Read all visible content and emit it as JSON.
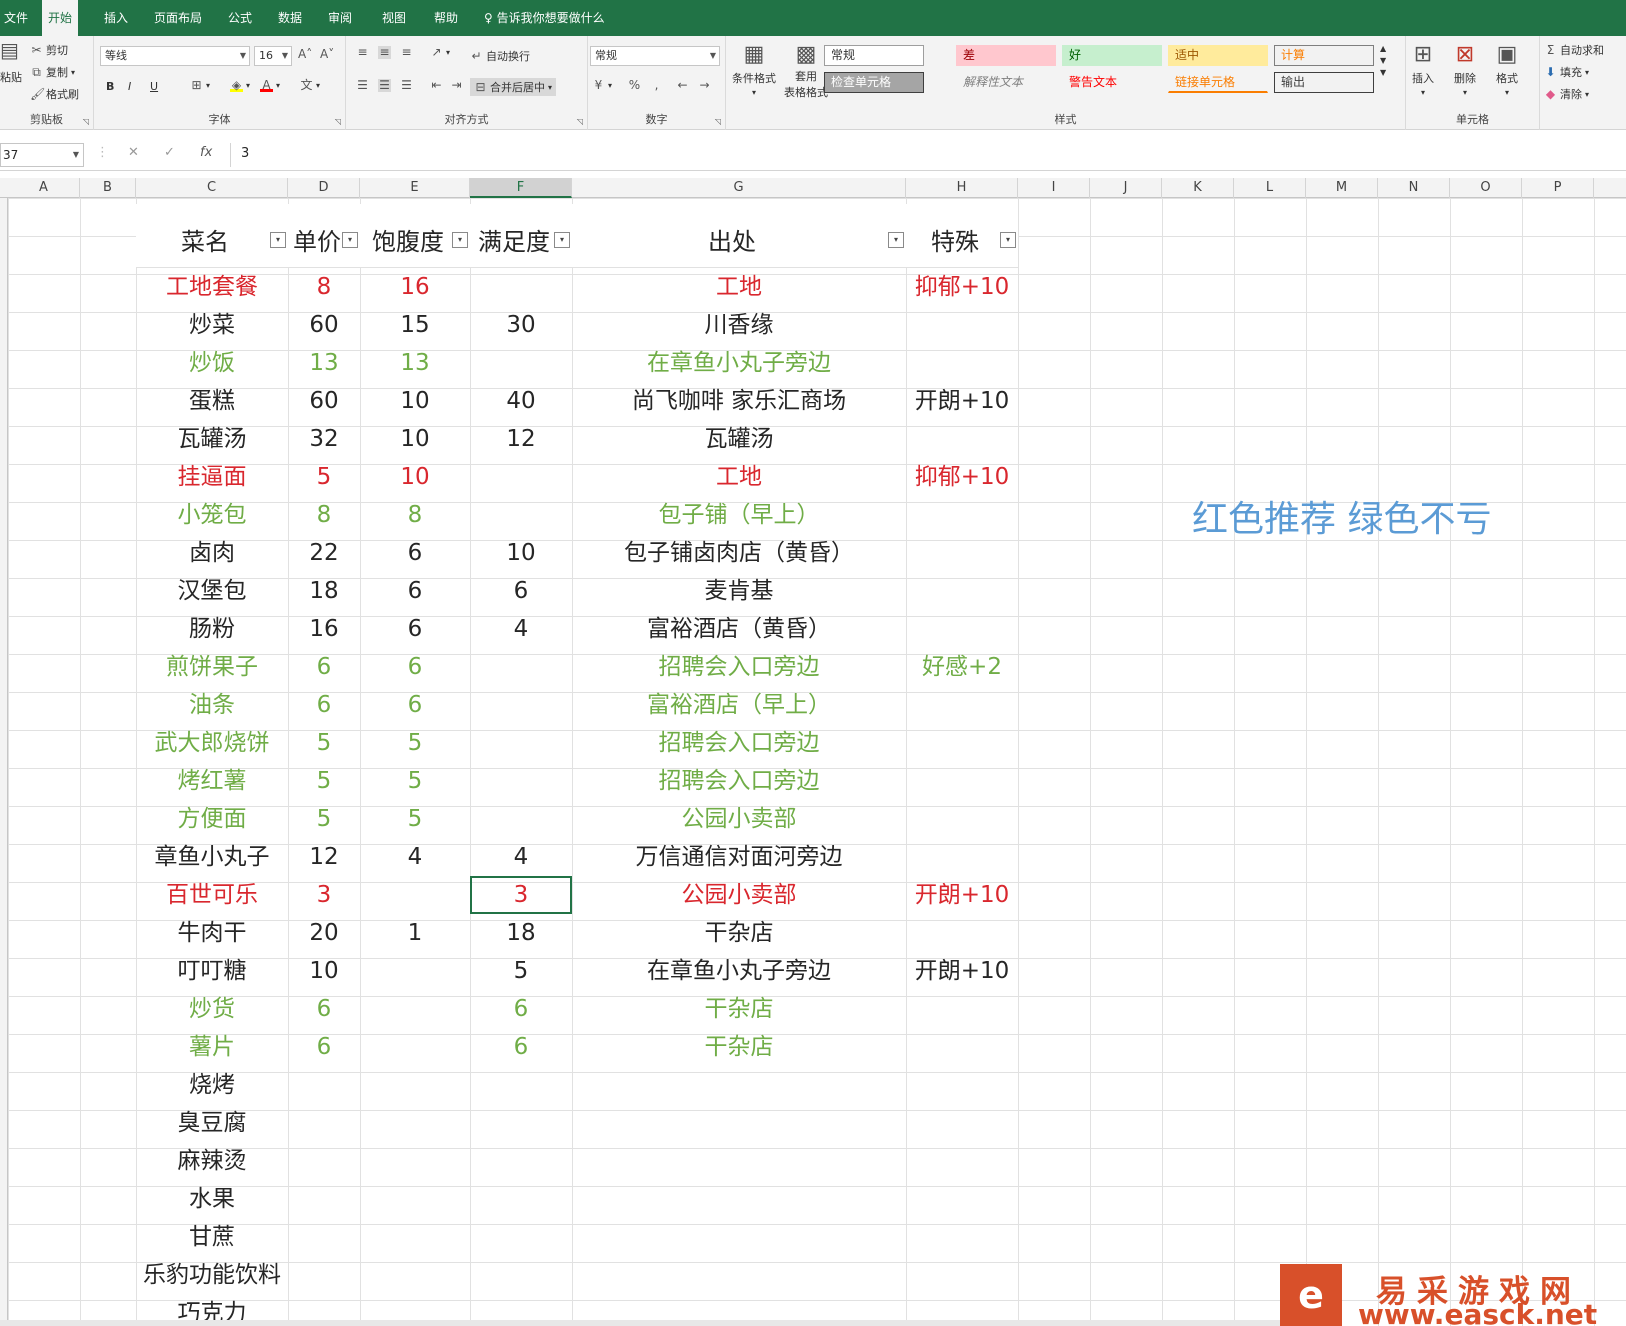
{
  "menu": {
    "tabs": [
      "文件",
      "开始",
      "插入",
      "页面布局",
      "公式",
      "数据",
      "审阅",
      "视图",
      "帮助"
    ],
    "active_index": 1,
    "tell_me": "告诉我你想要做什么"
  },
  "ribbon": {
    "clipboard": {
      "paste": "粘贴",
      "cut": "剪切",
      "copy": "复制",
      "format_painter": "格式刷",
      "label": "剪贴板"
    },
    "font": {
      "name": "等线",
      "size": "16",
      "bold": "B",
      "italic": "I",
      "underline": "U",
      "label": "字体"
    },
    "alignment": {
      "wrap": "自动换行",
      "merge": "合并后居中",
      "label": "对齐方式"
    },
    "number": {
      "format": "常规",
      "label": "数字"
    },
    "styles": {
      "conditional": "条件格式",
      "table_fmt_1": "套用",
      "table_fmt_2": "表格格式",
      "cells": [
        {
          "text": "常规",
          "bg": "#ffffff",
          "color": "#333333",
          "border": "#9e9e9e"
        },
        {
          "text": "差",
          "bg": "#ffc7ce",
          "color": "#9c0006",
          "border": "#ffc7ce"
        },
        {
          "text": "好",
          "bg": "#c6efce",
          "color": "#006100",
          "border": "#c6efce"
        },
        {
          "text": "适中",
          "bg": "#ffeb9c",
          "color": "#9c5700",
          "border": "#ffeb9c"
        },
        {
          "text": "计算",
          "bg": "#f2f2f2",
          "color": "#fa7d00",
          "border": "#7f7f7f"
        },
        {
          "text": "检查单元格",
          "bg": "#a5a5a5",
          "color": "#ffffff",
          "border": "#3f3f3f"
        },
        {
          "text": "解释性文本",
          "bg": "#f3f3f3",
          "color": "#7f7f7f",
          "border": "#f3f3f3"
        },
        {
          "text": "警告文本",
          "bg": "#f3f3f3",
          "color": "#ff0000",
          "border": "#f3f3f3"
        },
        {
          "text": "链接单元格",
          "bg": "#f3f3f3",
          "color": "#fa7d00",
          "border": "#f3f3f3"
        },
        {
          "text": "输出",
          "bg": "#f2f2f2",
          "color": "#3f3f3f",
          "border": "#3f3f3f"
        }
      ],
      "label": "样式"
    },
    "cells_group": {
      "insert": "插入",
      "delete": "删除",
      "format": "格式",
      "label": "单元格"
    },
    "editing": {
      "autosum": "自动求和",
      "fill": "填充",
      "clear": "清除"
    }
  },
  "formula_bar": {
    "name_box": "37",
    "formula": "3",
    "fx": "fx"
  },
  "columns": [
    "A",
    "B",
    "C",
    "D",
    "E",
    "F",
    "G",
    "H",
    "I",
    "J",
    "K",
    "L",
    "M",
    "N",
    "O",
    "P"
  ],
  "selected_column": "F",
  "colors": {
    "red": "#d9272e",
    "green": "#70ad47",
    "black": "#262626",
    "note": "#5b9bd5",
    "excel_green": "#217346"
  },
  "table": {
    "headers": [
      "菜名",
      "单价",
      "饱腹度",
      "满足度",
      "出处",
      "特殊"
    ],
    "rows": [
      {
        "c": "red",
        "v": [
          "工地套餐",
          "8",
          "16",
          "",
          "工地",
          "抑郁+10"
        ]
      },
      {
        "c": "black",
        "v": [
          "炒菜",
          "60",
          "15",
          "30",
          "川香缘",
          ""
        ]
      },
      {
        "c": "green",
        "v": [
          "炒饭",
          "13",
          "13",
          "",
          "在章鱼小丸子旁边",
          ""
        ]
      },
      {
        "c": "black",
        "v": [
          "蛋糕",
          "60",
          "10",
          "40",
          "尚飞咖啡  家乐汇商场",
          "开朗+10"
        ]
      },
      {
        "c": "black",
        "v": [
          "瓦罐汤",
          "32",
          "10",
          "12",
          "瓦罐汤",
          ""
        ]
      },
      {
        "c": "red",
        "v": [
          "挂逼面",
          "5",
          "10",
          "",
          "工地",
          "抑郁+10"
        ]
      },
      {
        "c": "green",
        "v": [
          "小笼包",
          "8",
          "8",
          "",
          "包子铺（早上）",
          ""
        ]
      },
      {
        "c": "black",
        "v": [
          "卤肉",
          "22",
          "6",
          "10",
          "包子铺卤肉店（黄昏）",
          ""
        ]
      },
      {
        "c": "black",
        "v": [
          "汉堡包",
          "18",
          "6",
          "6",
          "麦肯基",
          ""
        ]
      },
      {
        "c": "black",
        "v": [
          "肠粉",
          "16",
          "6",
          "4",
          "富裕酒店（黄昏）",
          ""
        ]
      },
      {
        "c": "green",
        "v": [
          "煎饼果子",
          "6",
          "6",
          "",
          "招聘会入口旁边",
          "好感+2"
        ]
      },
      {
        "c": "green",
        "v": [
          "油条",
          "6",
          "6",
          "",
          "富裕酒店（早上）",
          ""
        ]
      },
      {
        "c": "green",
        "v": [
          "武大郎烧饼",
          "5",
          "5",
          "",
          "招聘会入口旁边",
          ""
        ]
      },
      {
        "c": "green",
        "v": [
          "烤红薯",
          "5",
          "5",
          "",
          "招聘会入口旁边",
          ""
        ]
      },
      {
        "c": "green",
        "v": [
          "方便面",
          "5",
          "5",
          "",
          "公园小卖部",
          ""
        ]
      },
      {
        "c": "black",
        "v": [
          "章鱼小丸子",
          "12",
          "4",
          "4",
          "万信通信对面河旁边",
          ""
        ]
      },
      {
        "c": "red",
        "v": [
          "百世可乐",
          "3",
          "",
          "3",
          "公园小卖部",
          "开朗+10"
        ]
      },
      {
        "c": "black",
        "v": [
          "牛肉干",
          "20",
          "1",
          "18",
          "干杂店",
          ""
        ]
      },
      {
        "c": "black",
        "v": [
          "叮叮糖",
          "10",
          "",
          "5",
          "在章鱼小丸子旁边",
          "开朗+10"
        ]
      },
      {
        "c": "green",
        "v": [
          "炒货",
          "6",
          "",
          "6",
          "干杂店",
          ""
        ]
      },
      {
        "c": "green",
        "v": [
          "薯片",
          "6",
          "",
          "6",
          "干杂店",
          ""
        ]
      },
      {
        "c": "black",
        "v": [
          "烧烤",
          "",
          "",
          "",
          "",
          ""
        ]
      },
      {
        "c": "black",
        "v": [
          "臭豆腐",
          "",
          "",
          "",
          "",
          ""
        ]
      },
      {
        "c": "black",
        "v": [
          "麻辣烫",
          "",
          "",
          "",
          "",
          ""
        ]
      },
      {
        "c": "black",
        "v": [
          "水果",
          "",
          "",
          "",
          "",
          ""
        ]
      },
      {
        "c": "black",
        "v": [
          "甘蔗",
          "",
          "",
          "",
          "",
          ""
        ]
      },
      {
        "c": "black",
        "v": [
          "乐豹功能饮料",
          "",
          "",
          "",
          "",
          ""
        ]
      },
      {
        "c": "black",
        "v": [
          "巧克力",
          "",
          "",
          "",
          "",
          ""
        ]
      }
    ]
  },
  "note": "红色推荐 绿色不亏",
  "watermark": {
    "name": "易采游戏网",
    "url": "www.easck.net",
    "logo": "e"
  }
}
